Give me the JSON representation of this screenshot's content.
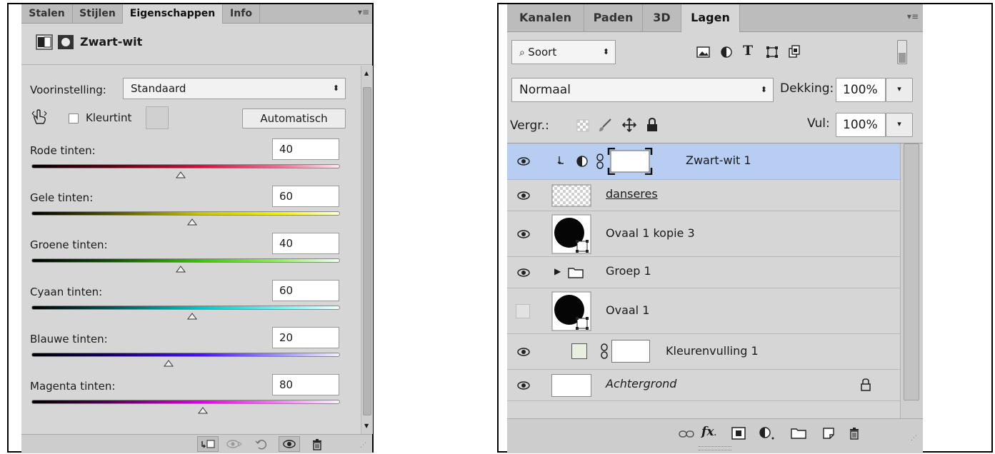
{
  "properties": {
    "tabs": [
      {
        "label": "Stalen"
      },
      {
        "label": "Stijlen"
      },
      {
        "label": "Eigenschappen",
        "active": true
      },
      {
        "label": "Info"
      }
    ],
    "title": "Zwart-wit",
    "preset_label": "Voorinstelling:",
    "preset_value": "Standaard",
    "tint_label": "Kleurtint",
    "auto_label": "Automatisch",
    "sliders": [
      {
        "label": "Rode tinten:",
        "value": "40",
        "pos": 0.484,
        "gradient": "linear-gradient(90deg,#000000 0%,#5a0012 25%,#d01040 55%,#f06a90 80%,#ffe6ee 100%)"
      },
      {
        "label": "Gele tinten:",
        "value": "60",
        "pos": 0.52,
        "gradient": "linear-gradient(90deg,#000000 0%,#4d4d00 25%,#c8c800 55%,#f2f200 80%,#ffffe0 100%)"
      },
      {
        "label": "Groene tinten:",
        "value": "40",
        "pos": 0.484,
        "gradient": "linear-gradient(90deg,#000000 0%,#0c4d00 25%,#3cc400 55%,#90f060 80%,#effff0 100%)"
      },
      {
        "label": "Cyaan tinten:",
        "value": "60",
        "pos": 0.52,
        "gradient": "linear-gradient(90deg,#000000 0%,#005050 25%,#00c6c6 55%,#70f0f0 80%,#efffff 100%)"
      },
      {
        "label": "Blauwe tinten:",
        "value": "20",
        "pos": 0.444,
        "gradient": "linear-gradient(90deg,#000000 0%,#150060 25%,#4a10ff 55%,#9a90f6 80%,#f2f0ff 100%)"
      },
      {
        "label": "Magenta tinten:",
        "value": "80",
        "pos": 0.556,
        "gradient": "linear-gradient(90deg,#000000 0%,#500050 25%,#e000e0 55%,#f080f0 80%,#fff0ff 100%)"
      }
    ]
  },
  "layers": {
    "tabs": [
      {
        "label": "Kanalen"
      },
      {
        "label": "Paden"
      },
      {
        "label": "3D"
      },
      {
        "label": "Lagen",
        "active": true
      }
    ],
    "filter_label": "Soort",
    "blend_mode": "Normaal",
    "opacity_label": "Dekking:",
    "opacity_value": "100%",
    "lock_label": "Vergr.:",
    "fill_label": "Vul:",
    "fill_value": "100%",
    "items": [
      {
        "name": "Zwart-wit 1",
        "selected": true,
        "visible": true
      },
      {
        "name": "danseres",
        "visible": true
      },
      {
        "name": "Ovaal 1 kopie 3",
        "visible": true
      },
      {
        "name": "Groep 1",
        "visible": true
      },
      {
        "name": "Ovaal 1",
        "visible": false
      },
      {
        "name": "Kleurenvulling 1",
        "visible": true
      },
      {
        "name": "Achtergrond",
        "visible": true
      }
    ]
  },
  "colors": {
    "panel_bg": "#d6d6d6",
    "selected_row": "#b8cdf2"
  }
}
